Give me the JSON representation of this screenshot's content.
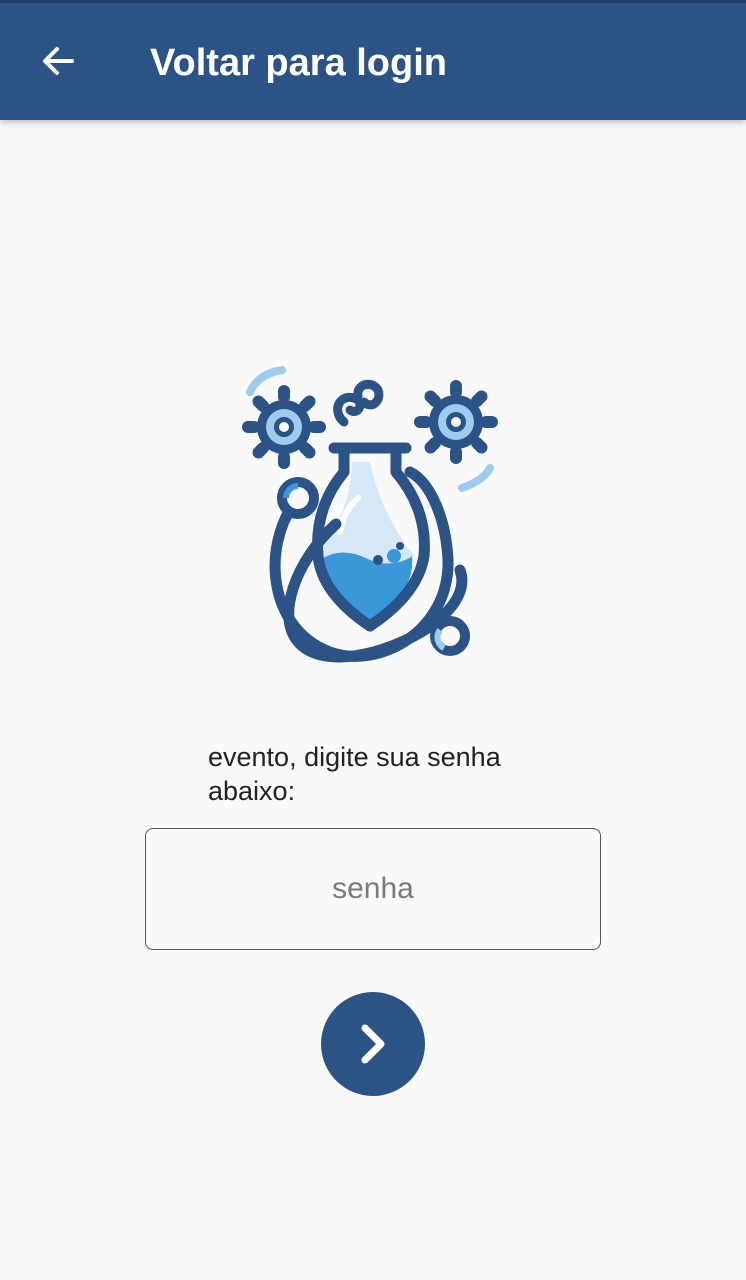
{
  "app_bar": {
    "title": "Voltar para login",
    "back_icon": "arrow-left-icon",
    "background": "#2b5386"
  },
  "illustration": {
    "icon": "science-flask-gears-icon",
    "primary_color": "#2b5386",
    "secondary_color": "#9ecbee",
    "liquid_color": "#3a97d8"
  },
  "instruction": {
    "text": "evento, digite sua senha abaixo:"
  },
  "password": {
    "placeholder": "senha",
    "value": ""
  },
  "submit": {
    "icon": "chevron-right-icon",
    "color": "#2b5386"
  }
}
